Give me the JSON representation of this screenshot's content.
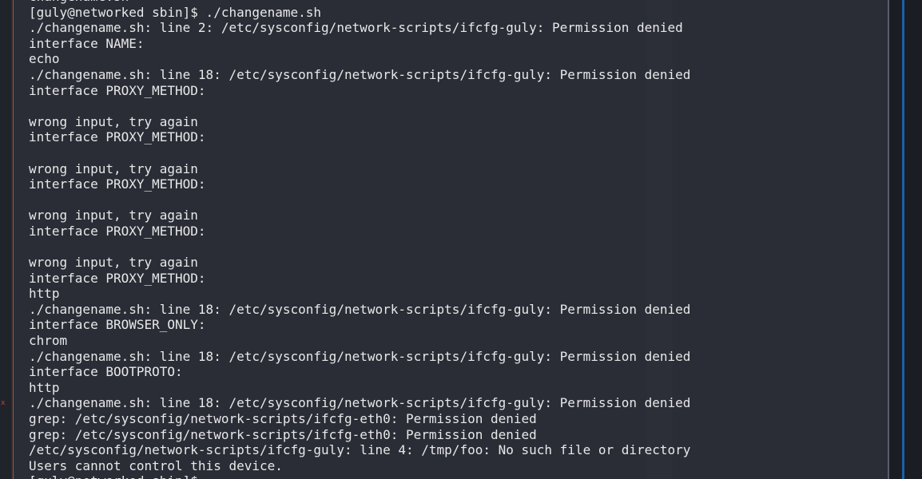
{
  "terminal": {
    "lines": [
      "changename.sh",
      "[guly@networked sbin]$ ./changename.sh",
      "./changename.sh: line 2: /etc/sysconfig/network-scripts/ifcfg-guly: Permission denied",
      "interface NAME:",
      "echo",
      "./changename.sh: line 18: /etc/sysconfig/network-scripts/ifcfg-guly: Permission denied",
      "interface PROXY_METHOD:",
      "",
      "wrong input, try again",
      "interface PROXY_METHOD:",
      "",
      "wrong input, try again",
      "interface PROXY_METHOD:",
      "",
      "wrong input, try again",
      "interface PROXY_METHOD:",
      "",
      "wrong input, try again",
      "interface PROXY_METHOD:",
      "http",
      "./changename.sh: line 18: /etc/sysconfig/network-scripts/ifcfg-guly: Permission denied",
      "interface BROWSER_ONLY:",
      "chrom",
      "./changename.sh: line 18: /etc/sysconfig/network-scripts/ifcfg-guly: Permission denied",
      "interface BOOTPROTO:",
      "http",
      "./changename.sh: line 18: /etc/sysconfig/network-scripts/ifcfg-guly: Permission denied",
      "grep: /etc/sysconfig/network-scripts/ifcfg-eth0: Permission denied",
      "grep: /etc/sysconfig/network-scripts/ifcfg-eth0: Permission denied",
      "/etc/sysconfig/network-scripts/ifcfg-guly: line 4: /tmp/foo: No such file or directory",
      "Users cannot control this device.",
      "[guly@networked sbin]$ "
    ]
  },
  "gutter_mark": "x",
  "colors": {
    "terminal_background": "#2a2d35",
    "text": "#e8e8ea",
    "left_accent": "#b5501e",
    "right_accent": "#1c5fa8"
  }
}
